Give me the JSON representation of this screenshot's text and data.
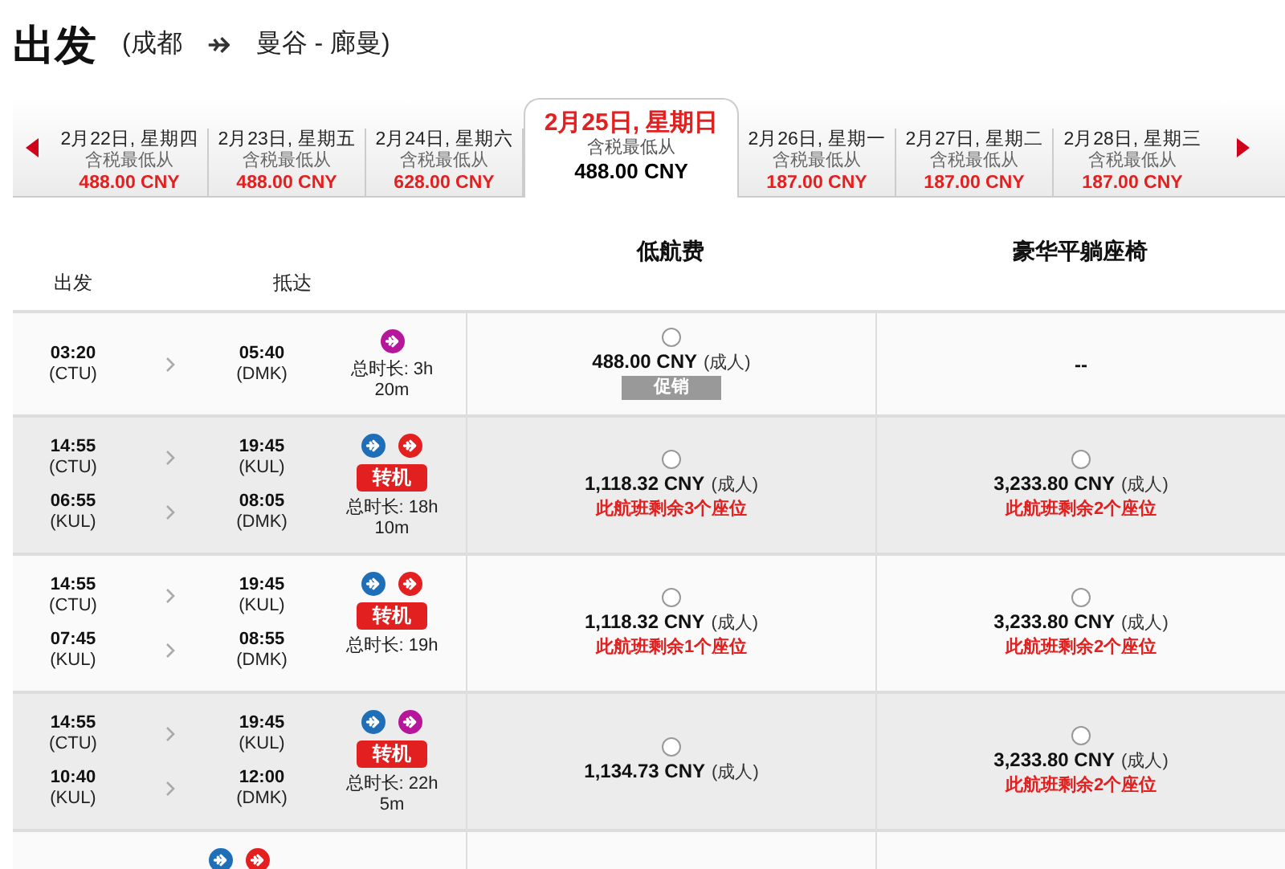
{
  "heading": {
    "title": "出发",
    "route_from": "(成都",
    "route_to": "曼谷 - 廊曼)"
  },
  "date_tabs": [
    {
      "date": "2月22日, 星期四",
      "label": "含税最低从",
      "price": "488.00 CNY",
      "selected": false
    },
    {
      "date": "2月23日, 星期五",
      "label": "含税最低从",
      "price": "488.00 CNY",
      "selected": false
    },
    {
      "date": "2月24日, 星期六",
      "label": "含税最低从",
      "price": "628.00 CNY",
      "selected": false
    },
    {
      "date": "2月25日, 星期日",
      "label": "含税最低从",
      "price": "488.00 CNY",
      "selected": true
    },
    {
      "date": "2月26日, 星期一",
      "label": "含税最低从",
      "price": "187.00 CNY",
      "selected": false
    },
    {
      "date": "2月27日, 星期二",
      "label": "含税最低从",
      "price": "187.00 CNY",
      "selected": false
    },
    {
      "date": "2月28日, 星期三",
      "label": "含税最低从",
      "price": "187.00 CNY",
      "selected": false
    }
  ],
  "table": {
    "columns": [
      "出发",
      "抵达"
    ],
    "fare_columns": [
      "低航费",
      "豪华平躺座椅"
    ],
    "rows": [
      {
        "airlines": [
          {
            "color": "#b5169a"
          }
        ],
        "legs": [
          {
            "dep_time": "03:20",
            "dep_code": "(CTU)",
            "arr_time": "05:40",
            "arr_code": "(DMK)"
          }
        ],
        "connection": null,
        "duration": "总时长: 3h 20m",
        "fares": [
          {
            "kind": "price",
            "selected": false,
            "price": "488.00 CNY",
            "unit": "(成人)",
            "badge": "促销"
          },
          {
            "kind": "none",
            "text": "--"
          }
        ]
      },
      {
        "airlines": [
          {
            "color": "#1e6fb8"
          },
          {
            "color": "#e32020"
          }
        ],
        "legs": [
          {
            "dep_time": "14:55",
            "dep_code": "(CTU)",
            "arr_time": "19:45",
            "arr_code": "(KUL)"
          },
          {
            "dep_time": "06:55",
            "dep_code": "(KUL)",
            "arr_time": "08:05",
            "arr_code": "(DMK)"
          }
        ],
        "connection": "转机",
        "duration": "总时长: 18h 10m",
        "fares": [
          {
            "kind": "price",
            "selected": false,
            "price": "1,118.32 CNY",
            "unit": "(成人)",
            "note": "此航班剩余3个座位"
          },
          {
            "kind": "price",
            "selected": false,
            "price": "3,233.80 CNY",
            "unit": "(成人)",
            "note": "此航班剩余2个座位"
          }
        ]
      },
      {
        "airlines": [
          {
            "color": "#1e6fb8"
          },
          {
            "color": "#e32020"
          }
        ],
        "legs": [
          {
            "dep_time": "14:55",
            "dep_code": "(CTU)",
            "arr_time": "19:45",
            "arr_code": "(KUL)"
          },
          {
            "dep_time": "07:45",
            "dep_code": "(KUL)",
            "arr_time": "08:55",
            "arr_code": "(DMK)"
          }
        ],
        "connection": "转机",
        "duration": "总时长: 19h",
        "fares": [
          {
            "kind": "price",
            "selected": false,
            "price": "1,118.32 CNY",
            "unit": "(成人)",
            "note": "此航班剩余1个座位"
          },
          {
            "kind": "price",
            "selected": false,
            "price": "3,233.80 CNY",
            "unit": "(成人)",
            "note": "此航班剩余2个座位"
          }
        ]
      },
      {
        "airlines": [
          {
            "color": "#1e6fb8"
          },
          {
            "color": "#b5169a"
          }
        ],
        "legs": [
          {
            "dep_time": "14:55",
            "dep_code": "(CTU)",
            "arr_time": "19:45",
            "arr_code": "(KUL)"
          },
          {
            "dep_time": "10:40",
            "dep_code": "(KUL)",
            "arr_time": "12:00",
            "arr_code": "(DMK)"
          }
        ],
        "connection": "转机",
        "duration": "总时长: 22h 5m",
        "fares": [
          {
            "kind": "price",
            "selected": false,
            "price": "1,134.73 CNY",
            "unit": "(成人)"
          },
          {
            "kind": "price",
            "selected": false,
            "price": "3,233.80 CNY",
            "unit": "(成人)",
            "note": "此航班剩余2个座位"
          }
        ]
      },
      {
        "airlines": [
          {
            "color": "#1e6fb8"
          },
          {
            "color": "#e32020"
          }
        ]
      }
    ]
  }
}
